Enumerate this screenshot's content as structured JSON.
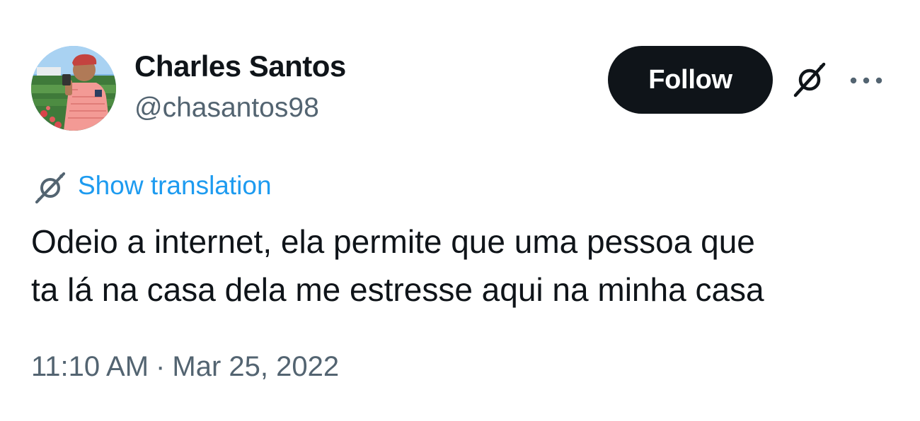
{
  "author": {
    "display_name": "Charles Santos",
    "handle": "@chasantos98",
    "avatar_icon": "profile-photo"
  },
  "actions": {
    "follow_label": "Follow",
    "grok_icon": "grok-icon",
    "more_icon": "more-icon"
  },
  "translation": {
    "icon": "grok-icon",
    "label": "Show translation"
  },
  "tweet": {
    "text_lines": [
      "Odeio a internet, ela permite que uma pessoa que",
      "ta lá na casa dela me estresse aqui na minha casa"
    ]
  },
  "meta": {
    "time": "11:10 AM",
    "separator": "·",
    "date": "Mar 25, 2022"
  },
  "colors": {
    "text": "#0f1419",
    "secondary": "#536471",
    "link": "#1d9bf0",
    "button_bg": "#0f1419",
    "button_text": "#ffffff"
  }
}
